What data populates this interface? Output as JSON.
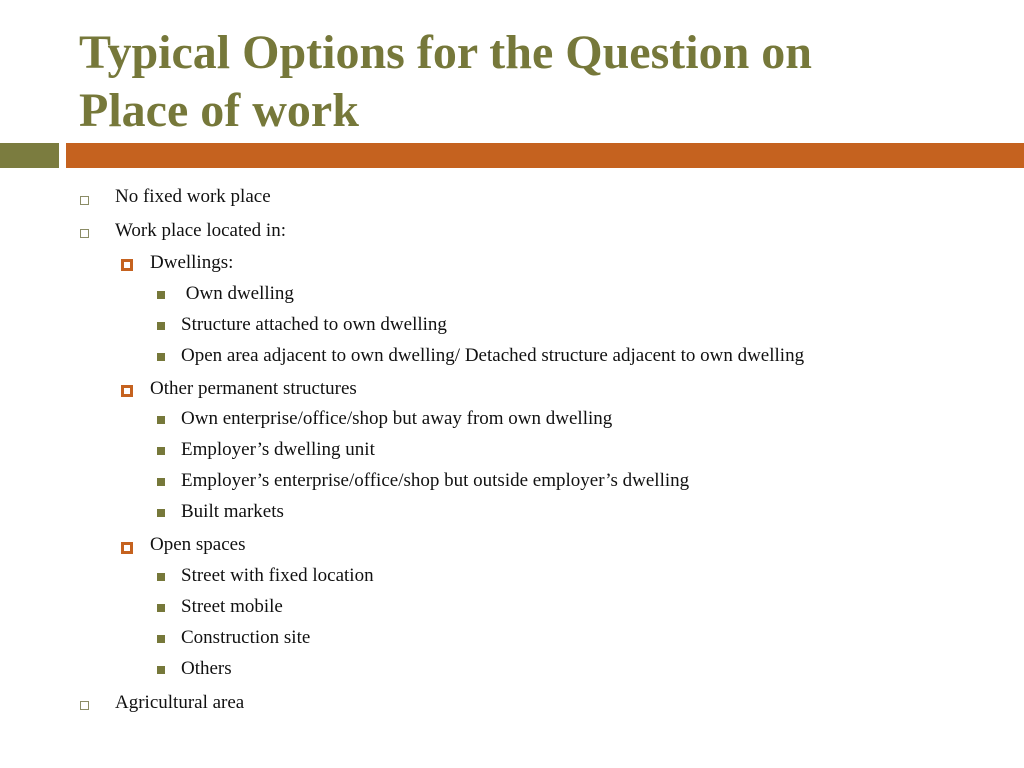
{
  "slide": {
    "title_lines": [
      "Typical Options for the Question on",
      "Place of work"
    ],
    "colors": {
      "title": "#76783a",
      "accent_green": "#7b7c3f",
      "accent_orange": "#c5621f"
    },
    "items": [
      {
        "level": 1,
        "text": "No fixed work place"
      },
      {
        "level": 1,
        "text": "Work place located in:"
      },
      {
        "level": 2,
        "text": "Dwellings:"
      },
      {
        "level": 3,
        "text": " Own dwelling"
      },
      {
        "level": 3,
        "text": "Structure attached to own dwelling"
      },
      {
        "level": 3,
        "text": "Open area adjacent to own dwelling/ Detached structure adjacent to own dwelling"
      },
      {
        "level": 2,
        "text": "Other permanent structures"
      },
      {
        "level": 3,
        "text": "Own enterprise/office/shop but away from own dwelling"
      },
      {
        "level": 3,
        "text": "Employer’s dwelling unit"
      },
      {
        "level": 3,
        "text": "Employer’s enterprise/office/shop but outside employer’s dwelling"
      },
      {
        "level": 3,
        "text": "Built markets"
      },
      {
        "level": 2,
        "text": "Open spaces"
      },
      {
        "level": 3,
        "text": "Street with fixed location"
      },
      {
        "level": 3,
        "text": "Street mobile"
      },
      {
        "level": 3,
        "text": "Construction site"
      },
      {
        "level": 3,
        "text": "Others"
      },
      {
        "level": 1,
        "text": "Agricultural area"
      }
    ]
  }
}
